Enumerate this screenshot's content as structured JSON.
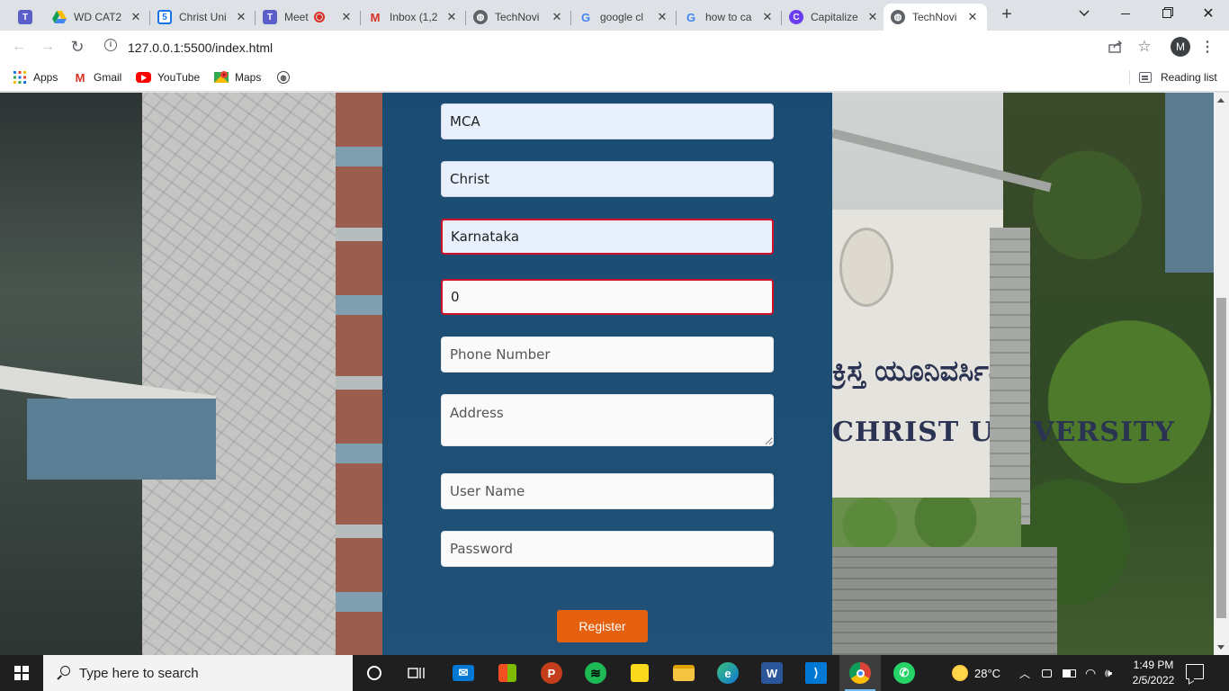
{
  "browser": {
    "tabs": [
      {
        "title": "WD CAT2",
        "icon": "drive-icon",
        "color": "#1a73e8"
      },
      {
        "title": "Christ Uni",
        "icon": "classroom-icon",
        "color": "#188038"
      },
      {
        "title": "Meet",
        "icon": "teams-icon",
        "color": "#5b5fc7"
      },
      {
        "title": "Inbox (1,2",
        "icon": "gmail-icon",
        "color": "#d93025"
      },
      {
        "title": "TechNovi",
        "icon": "globe-icon",
        "color": "#5f6368"
      },
      {
        "title": "google cl",
        "icon": "google-icon",
        "color": "#4285f4"
      },
      {
        "title": "how to ca",
        "icon": "google-icon",
        "color": "#4285f4"
      },
      {
        "title": "Capitalize",
        "icon": "capitalize-icon",
        "color": "#6a3df2"
      },
      {
        "title": "TechNovi",
        "icon": "globe-icon",
        "color": "#5f6368"
      }
    ],
    "url": "127.0.0.1:5500/index.html",
    "profile_initial": "M",
    "bookmarks": [
      {
        "label": "Apps",
        "icon": "apps-grid-icon"
      },
      {
        "label": "Gmail",
        "icon": "gmail-icon"
      },
      {
        "label": "YouTube",
        "icon": "youtube-icon"
      },
      {
        "label": "Maps",
        "icon": "maps-icon"
      },
      {
        "label": "",
        "icon": "globe-icon"
      }
    ],
    "reading_list": "Reading list"
  },
  "form": {
    "course": "MCA",
    "college": "Christ",
    "state": "Karnataka",
    "number_value": "0",
    "phone_placeholder": "Phone Number",
    "address_placeholder": "Address",
    "username_placeholder": "User Name",
    "password_placeholder": "Password",
    "register_label": "Register"
  },
  "background": {
    "sign_kannada": "ಕ್ರಿಸ್ತ ಯೂನಿವರ್ಸಿಟಿ",
    "sign_english": "CHRIST UNIVERSITY"
  },
  "taskbar": {
    "search_placeholder": "Type here to search",
    "weather": "28°C",
    "time": "1:49 PM",
    "date": "2/5/2022"
  },
  "colors": {
    "panel": "#0e446e",
    "register_button": "#e5600f",
    "invalid_border": "#d0102a"
  }
}
